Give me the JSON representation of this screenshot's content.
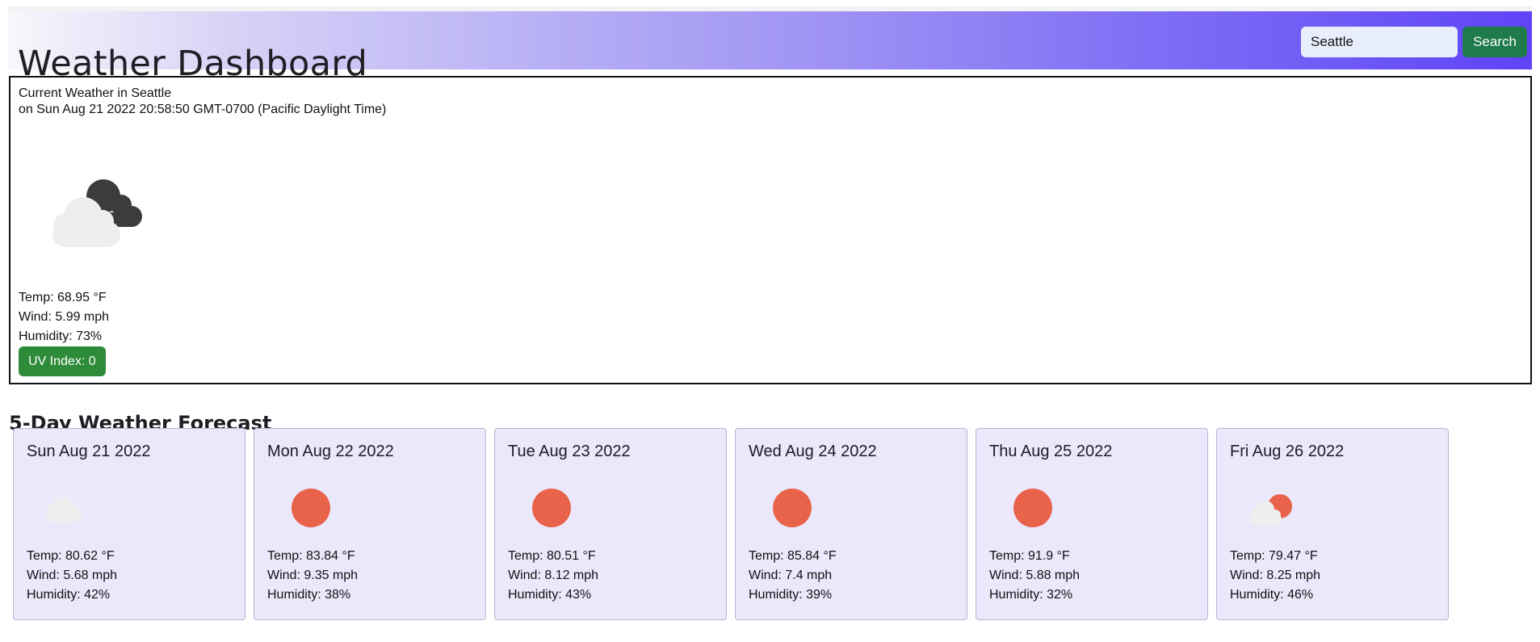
{
  "header": {
    "title": "Weather Dashboard",
    "search_value": "Seattle",
    "search_button": "Search"
  },
  "current": {
    "heading": "Current Weather in Seattle",
    "datetime": "on Sun Aug 21 2022 20:58:50 GMT-0700 (Pacific Daylight Time)",
    "icon": "night-partly-cloudy-icon",
    "temp": "Temp: 68.95 °F",
    "wind": "Wind: 5.99 mph",
    "humidity": "Humidity: 73%",
    "uv": "UV Index: 0",
    "uv_color": "#2e8b3a"
  },
  "forecast": {
    "title": "5-Day Weather Forecast",
    "days": [
      {
        "date": "Sun Aug 21 2022",
        "icon": "cloud-icon",
        "temp": "Temp: 80.62 °F",
        "wind": "Wind: 5.68 mph",
        "humidity": "Humidity: 42%"
      },
      {
        "date": "Mon Aug 22 2022",
        "icon": "sun-icon",
        "temp": "Temp: 83.84 °F",
        "wind": "Wind: 9.35 mph",
        "humidity": "Humidity: 38%"
      },
      {
        "date": "Tue Aug 23 2022",
        "icon": "sun-icon",
        "temp": "Temp: 80.51 °F",
        "wind": "Wind: 8.12 mph",
        "humidity": "Humidity: 43%"
      },
      {
        "date": "Wed Aug 24 2022",
        "icon": "sun-icon",
        "temp": "Temp: 85.84 °F",
        "wind": "Wind: 7.4 mph",
        "humidity": "Humidity: 39%"
      },
      {
        "date": "Thu Aug 25 2022",
        "icon": "sun-icon",
        "temp": "Temp: 91.9 °F",
        "wind": "Wind: 5.88 mph",
        "humidity": "Humidity: 32%"
      },
      {
        "date": "Fri Aug 26 2022",
        "icon": "partly-cloudy-icon",
        "temp": "Temp: 79.47 °F",
        "wind": "Wind: 8.25 mph",
        "humidity": "Humidity: 46%"
      }
    ]
  },
  "colors": {
    "accent": "#5f44f7",
    "button": "#1f7a4c",
    "card_bg": "#ebe8fb",
    "sun": "#e8634a"
  }
}
